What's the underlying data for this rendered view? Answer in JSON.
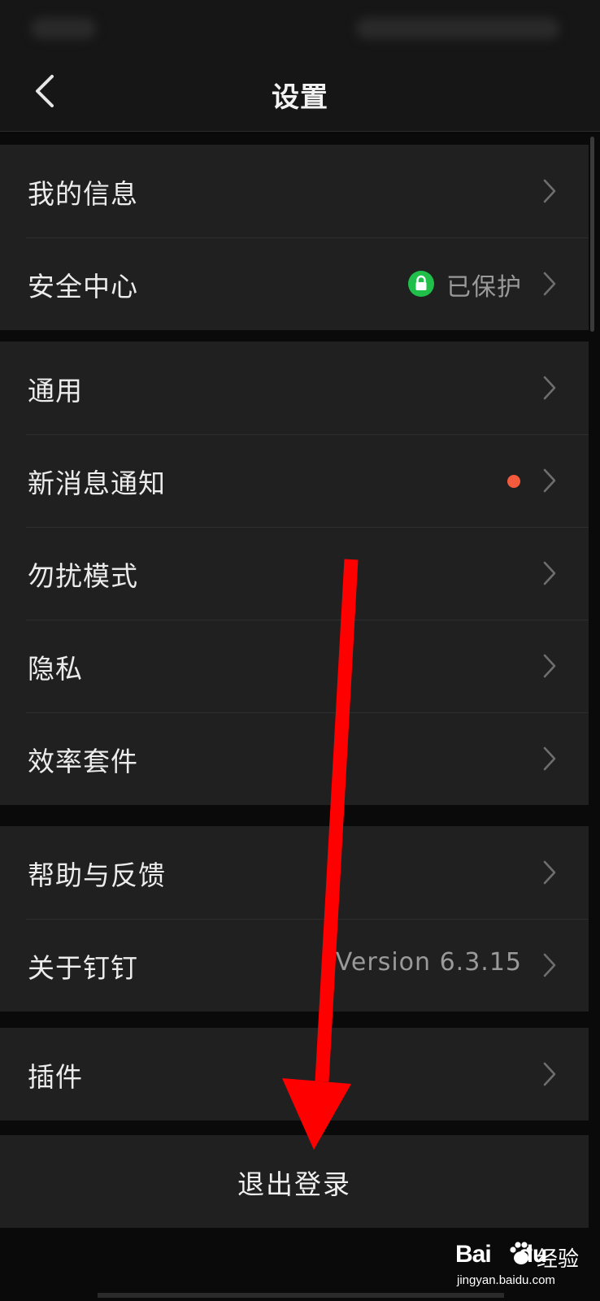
{
  "header": {
    "title": "设置"
  },
  "groups": [
    {
      "items": [
        {
          "label": "我的信息"
        },
        {
          "label": "安全中心",
          "value": "已保护"
        }
      ]
    },
    {
      "items": [
        {
          "label": "通用"
        },
        {
          "label": "新消息通知"
        },
        {
          "label": "勿扰模式"
        },
        {
          "label": "隐私"
        },
        {
          "label": "效率套件"
        }
      ]
    },
    {
      "items": [
        {
          "label": "帮助与反馈"
        },
        {
          "label": "关于钉钉",
          "value": "Version 6.3.15"
        }
      ]
    },
    {
      "items": [
        {
          "label": "插件"
        }
      ]
    }
  ],
  "logout": {
    "label": "退出登录"
  },
  "watermark": {
    "brand": "Bai",
    "brand_suffix": "du",
    "cn": "经验",
    "url": "jingyan.baidu.com"
  },
  "colors": {
    "background": "#0a0a0a",
    "row_background": "#202020",
    "secure_green": "#1fbf4a",
    "notification_dot": "#f45b3c",
    "annotation_arrow": "#ff0000"
  }
}
